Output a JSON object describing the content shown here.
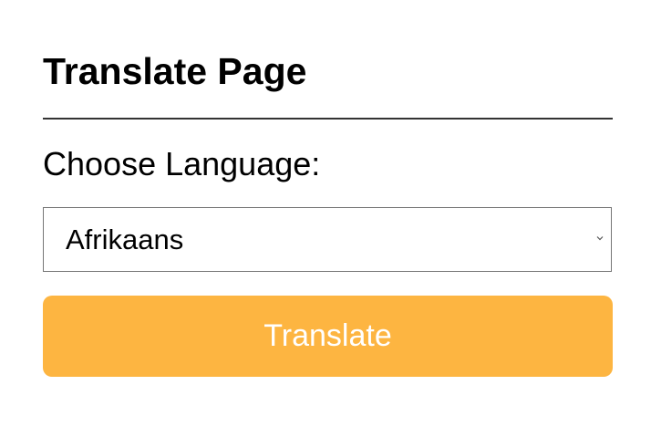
{
  "header": {
    "title": "Translate Page"
  },
  "form": {
    "language_label": "Choose Language:",
    "language_select": {
      "selected": "Afrikaans"
    },
    "translate_button_label": "Translate"
  },
  "colors": {
    "button_background": "#fdb541",
    "button_text": "#ffffff",
    "divider": "#333333",
    "select_border": "#767676"
  },
  "icons": {
    "select_arrow": "chevron-down-icon"
  }
}
